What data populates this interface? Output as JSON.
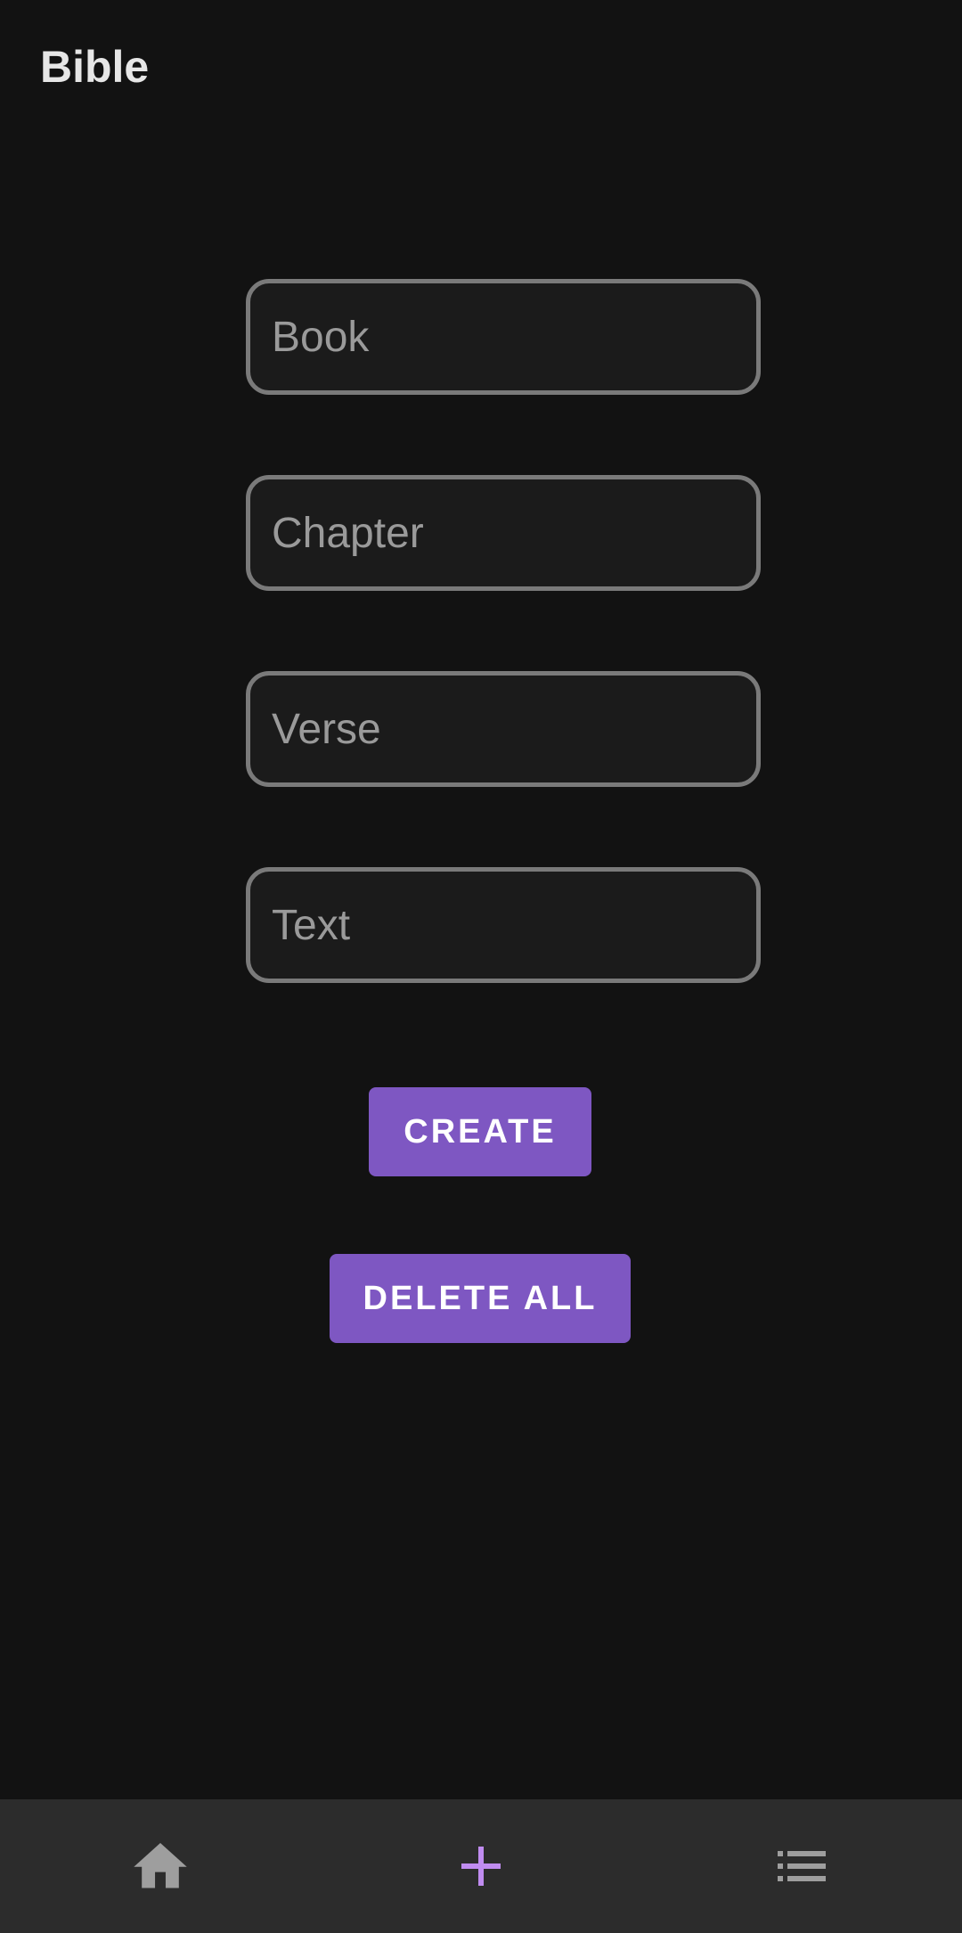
{
  "app": {
    "title": "Bible"
  },
  "form": {
    "book_placeholder": "Book",
    "chapter_placeholder": "Chapter",
    "verse_placeholder": "Verse",
    "text_placeholder": "Text"
  },
  "actions": {
    "create_label": "CREATE",
    "delete_all_label": "DELETE ALL"
  },
  "bottom_nav": {
    "items": [
      {
        "icon": "home-icon",
        "active": false
      },
      {
        "icon": "add-icon",
        "active": true
      },
      {
        "icon": "list-icon",
        "active": false
      }
    ],
    "active_color": "#c08cf0",
    "inactive_color": "#9e9e9e"
  },
  "colors": {
    "background": "#121212",
    "button": "#7e57c2",
    "nav_background": "#2c2c2c",
    "field_border": "#7a7a7a"
  }
}
